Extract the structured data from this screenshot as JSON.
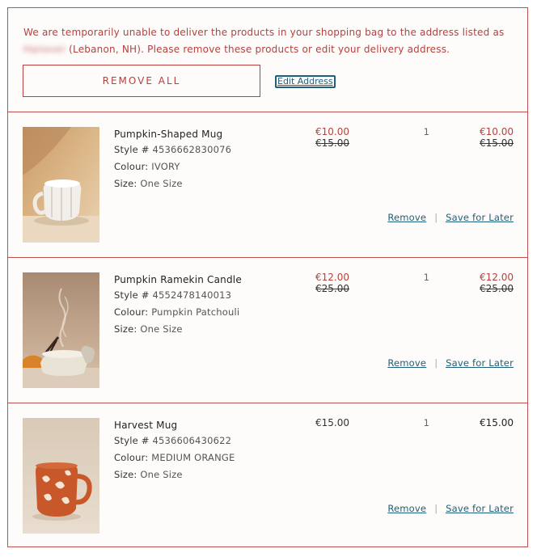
{
  "alert": {
    "message_part1": "We are temporarily unable to deliver the products in your shopping bag to the address listed as",
    "masked_part": "Hanover",
    "message_part2": "(Lebanon, NH). Please remove these products or edit your delivery address.",
    "remove_all_label": "REMOVE ALL",
    "edit_address_label": "Edit Address"
  },
  "labels": {
    "style_prefix": "Style #",
    "colour_label": "Colour:",
    "size_label": "Size:",
    "remove": "Remove",
    "separator": "|",
    "save_for_later": "Save for Later"
  },
  "items": [
    {
      "name": "Pumpkin-Shaped Mug",
      "style": "4536662830076",
      "colour": "IVORY",
      "size": "One Size",
      "sale_price": "€10.00",
      "original_price": "€15.00",
      "quantity": "1",
      "total_sale": "€10.00",
      "total_original": "€15.00"
    },
    {
      "name": "Pumpkin Ramekin Candle",
      "style": "4552478140013",
      "colour": "Pumpkin Patchouli",
      "size": "One Size",
      "sale_price": "€12.00",
      "original_price": "€25.00",
      "quantity": "1",
      "total_sale": "€12.00",
      "total_original": "€25.00"
    },
    {
      "name": "Harvest Mug",
      "style": "4536606430622",
      "colour": "MEDIUM ORANGE",
      "size": "One Size",
      "price": "€15.00",
      "quantity": "1",
      "total": "€15.00"
    }
  ],
  "colors": {
    "accent_red": "#b5413e",
    "link_teal": "#1f5f7a",
    "border": "#c0504d"
  }
}
